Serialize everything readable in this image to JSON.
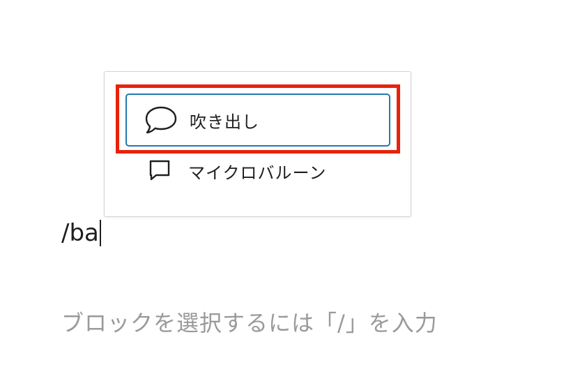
{
  "autocomplete": {
    "options": [
      {
        "label": "吹き出し",
        "icon": "speech-bubble-round-icon",
        "selected": true
      },
      {
        "label": "マイクロバルーン",
        "icon": "speech-bubble-square-icon",
        "selected": false
      }
    ]
  },
  "annotation": {
    "highlight_color": "#e8220c"
  },
  "editor": {
    "typed_text": "/ba",
    "placeholder": "ブロックを選択するには「/」を入力"
  },
  "colors": {
    "selection_border": "#1e7bb0",
    "text": "#1e1e1e",
    "placeholder": "#9a9a9a"
  }
}
